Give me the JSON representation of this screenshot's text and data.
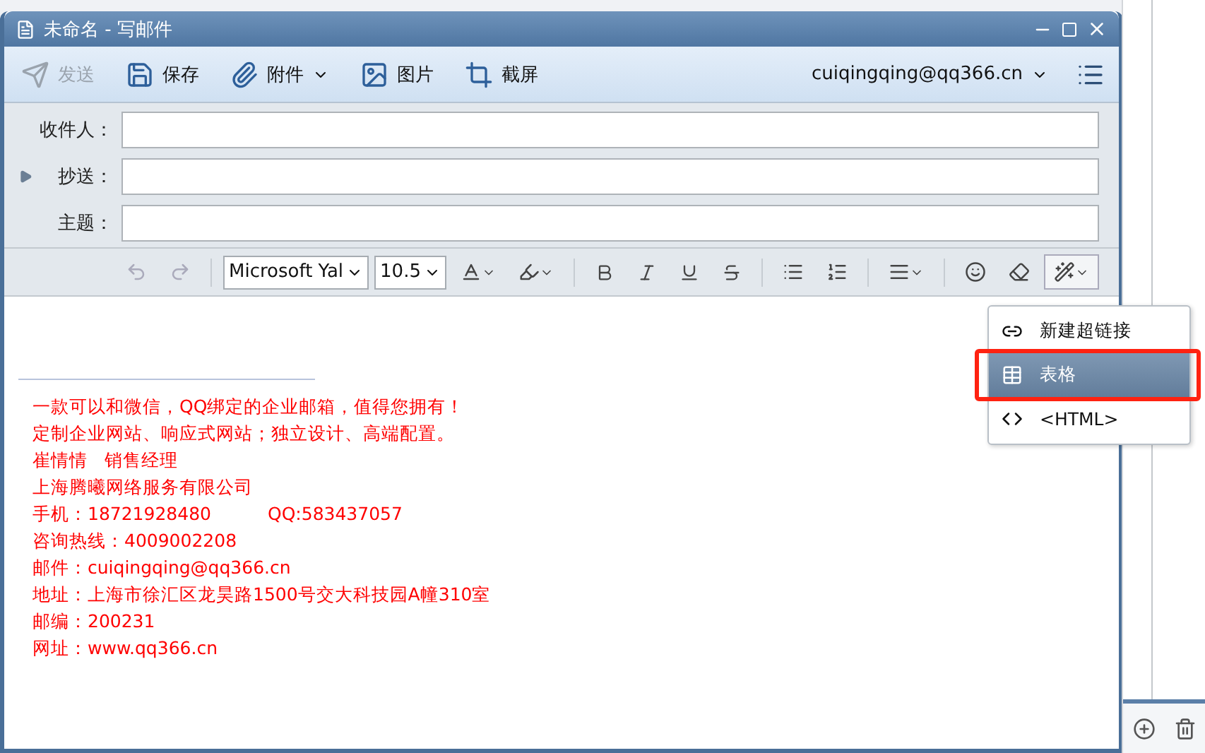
{
  "window": {
    "title": "未命名 - 写邮件"
  },
  "toolbar": {
    "buttons": [
      {
        "kind": "send",
        "label": "发送",
        "disabled": true
      },
      {
        "kind": "save",
        "label": "保存",
        "disabled": false
      },
      {
        "kind": "attach",
        "label": "附件",
        "disabled": false,
        "dropdown": true
      },
      {
        "kind": "image",
        "label": "图片",
        "disabled": false
      },
      {
        "kind": "screenshot",
        "label": "截屏",
        "disabled": false
      }
    ],
    "account": "cuiqingqing@qq366.cn"
  },
  "fields": [
    {
      "label": "收件人：",
      "expandable": false
    },
    {
      "label": "抄送：",
      "expandable": true
    },
    {
      "label": "主题：",
      "expandable": false
    }
  ],
  "format_toolbar": {
    "undo": {
      "disabled": true
    },
    "redo": {
      "disabled": true
    },
    "font": "Microsoft Yal",
    "size": "10.5"
  },
  "insert_menu": {
    "items": [
      {
        "kind": "link",
        "label": "新建超链接",
        "selected": false,
        "annotated": false
      },
      {
        "kind": "table",
        "label": "表格",
        "selected": true,
        "annotated": true
      },
      {
        "kind": "html",
        "label": "<HTML>",
        "selected": false,
        "annotated": false
      }
    ]
  },
  "signature": {
    "lines": [
      [
        "一款可以和微信，QQ绑定的企业邮箱，值得您拥有！"
      ],
      [
        "定制企业网站、响应式网站；独立设计、高端配置。"
      ],
      [
        "崔情情",
        "销售经理"
      ],
      [
        "上海腾曦网络服务有限公司"
      ],
      [
        "手机：18721928480",
        "QQ:583437057"
      ],
      [
        "咨询热线：4009002208"
      ],
      [
        "邮件：cuiqingqing@qq366.cn"
      ],
      [
        "地址：上海市徐汇区龙昊路1500号交大科技园A幢310室"
      ],
      [
        "邮编：200231"
      ],
      [
        "网址：www.qq366.cn"
      ]
    ]
  }
}
